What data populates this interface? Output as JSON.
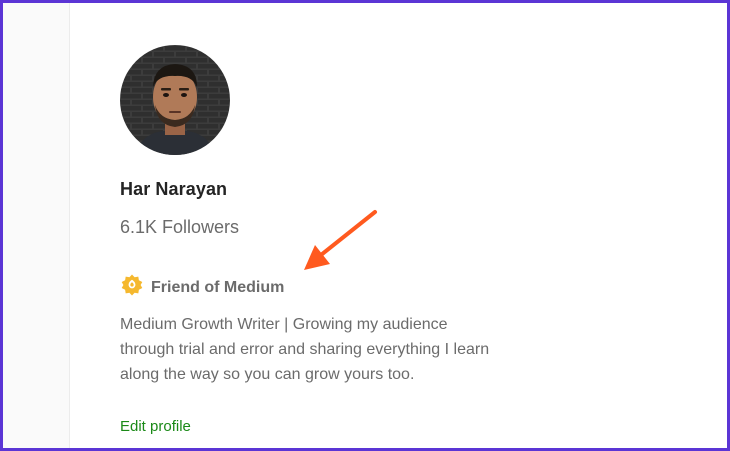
{
  "profile": {
    "name": "Har Narayan",
    "followers": "6.1K Followers",
    "badge_label": "Friend of Medium",
    "badge_icon": "friend-of-medium-star-icon",
    "bio": "Medium Growth Writer | Growing my audience through trial and error and sharing everything I learn along the way so you can grow yours too.",
    "edit_profile_label": "Edit profile"
  },
  "colors": {
    "frame_border": "#5b35d5",
    "badge_gold": "#f5b82e",
    "link_green": "#1a8917",
    "annotation_arrow": "#ff5a1f",
    "muted_text": "#6b6b6b",
    "name_text": "#242424"
  },
  "annotation": {
    "icon": "arrow-pointer-icon"
  }
}
